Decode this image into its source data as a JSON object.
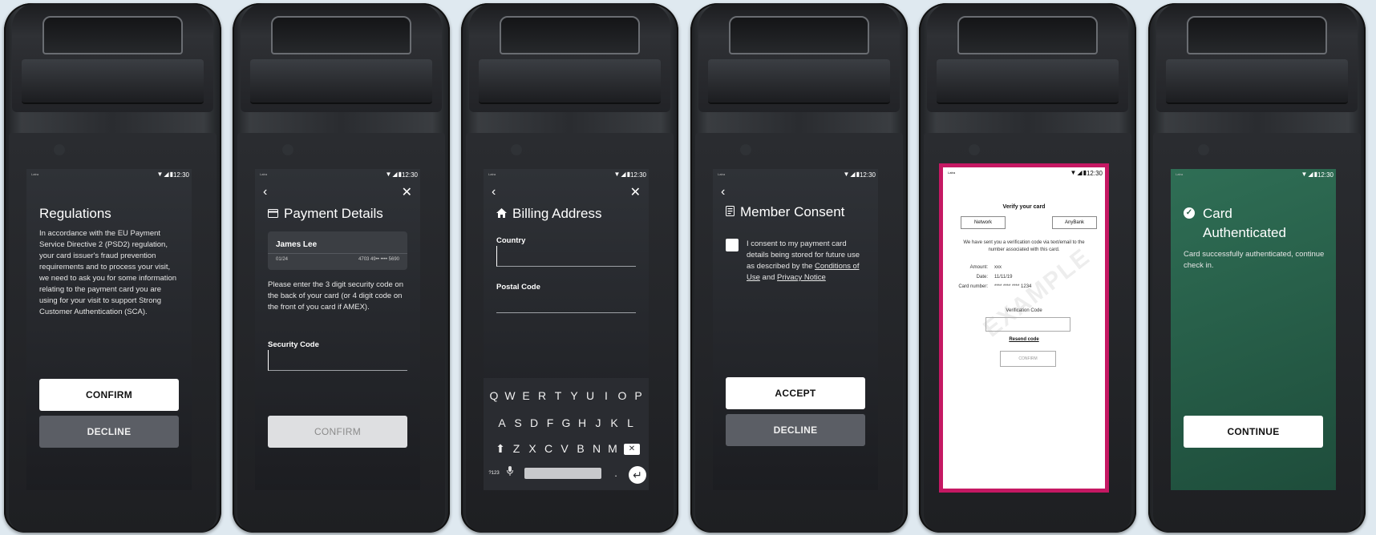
{
  "statusbar": {
    "carrier": "Latra",
    "icons": "▼◢▮",
    "time": "12:30"
  },
  "screens": {
    "regulations": {
      "title": "Regulations",
      "body": "In accordance with the EU Payment Service Directive 2 (PSD2) regulation, your card issuer's fraud prevention requirements and to process your visit, we need to ask you for some information relating to the payment card you are using for your visit to support Strong Customer Authentication (SCA).",
      "confirm_label": "CONFIRM",
      "decline_label": "DECLINE"
    },
    "payment": {
      "back": "‹",
      "close": "✕",
      "title": "Payment Details",
      "card_name": "James Lee",
      "card_expiry": "01/24",
      "card_number": "4703 49•• •••• 5690",
      "instructions": "Please enter the 3 digit security code on the back of your card (or 4 digit code on the front of you card if AMEX).",
      "field_label": "Security Code",
      "confirm_label": "CONFIRM"
    },
    "billing": {
      "back": "‹",
      "close": "✕",
      "title": "Billing Address",
      "country_label": "Country",
      "postal_label": "Postal Code",
      "keyboard": {
        "row1": [
          "Q",
          "W",
          "E",
          "R",
          "T",
          "Y",
          "U",
          "I",
          "O",
          "P"
        ],
        "row2": [
          "A",
          "S",
          "D",
          "F",
          "G",
          "H",
          "J",
          "K",
          "L"
        ],
        "row3": [
          "Z",
          "X",
          "C",
          "V",
          "B",
          "N",
          "M"
        ],
        "symbols_key": "?123",
        "mic": "🎙",
        "period": ".",
        "shift": "⬆",
        "delete": "✕",
        "enter": "↵"
      }
    },
    "consent": {
      "back": "‹",
      "title": "Member Consent",
      "text_before": "I consent to my payment card details being stored for future use as described by the ",
      "link1": "Conditions of Use",
      "text_and": " and ",
      "link2": "Privacy Notice",
      "accept_label": "ACCEPT",
      "decline_label": "DECLINE"
    },
    "verify": {
      "title": "Verify your card",
      "network": "Network",
      "bank": "AnyBank",
      "message": "We have sent you a verification code via text/email to the number associated with this card.",
      "amount_label": "Amount:",
      "amount_value": "xxx",
      "date_label": "Date:",
      "date_value": "11/11/19",
      "cardnum_label": "Card number:",
      "cardnum_value": "**** **** **** 1234",
      "code_label": "Verification Code",
      "resend": "Resend code",
      "confirm": "CONFIRM",
      "watermark": "EXAMPLE"
    },
    "authenticated": {
      "title_line1": "Card",
      "title_line2": "Authenticated",
      "body": "Card successfully authenticated, continue check in.",
      "continue_label": "CONTINUE"
    }
  }
}
